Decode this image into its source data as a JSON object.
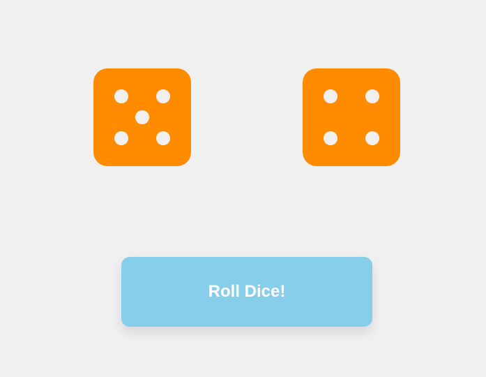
{
  "dice": [
    {
      "value": 5
    },
    {
      "value": 4
    }
  ],
  "colors": {
    "background": "#f0f0f0",
    "die": "#ff8c00",
    "pip": "#f0f0f0",
    "button": "#87ceeb",
    "button_text": "#ffffff"
  },
  "roll_button": {
    "label": "Roll Dice!"
  }
}
